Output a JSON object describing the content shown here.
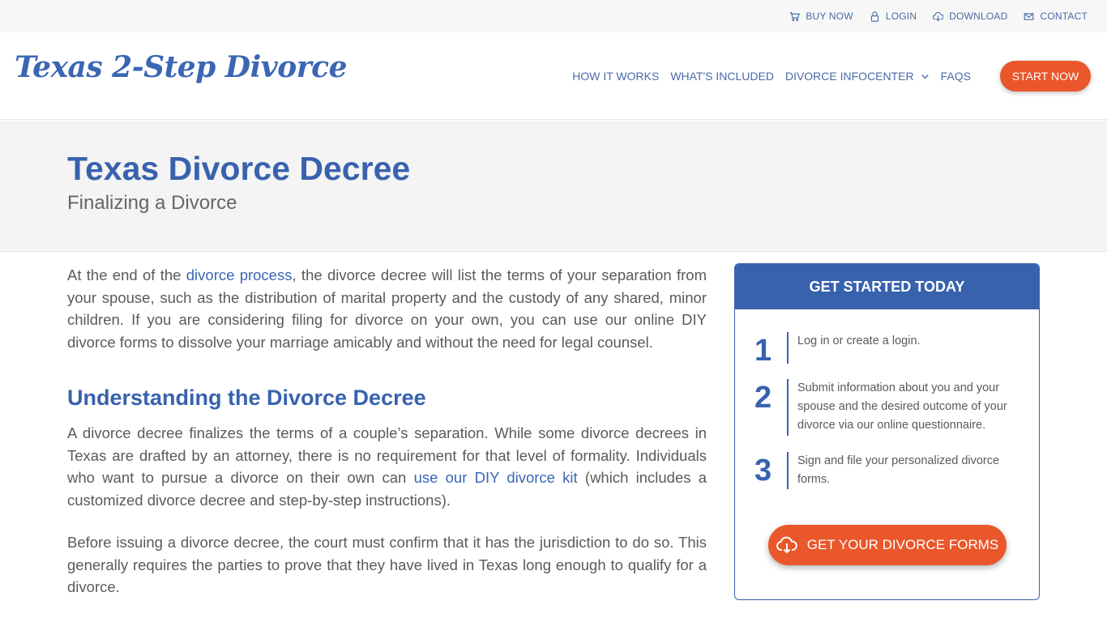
{
  "topbar": {
    "links": [
      {
        "label": "BUY NOW",
        "icon": "cart-icon"
      },
      {
        "label": "LOGIN",
        "icon": "lock-icon"
      },
      {
        "label": "DOWNLOAD",
        "icon": "cloud-download-icon"
      },
      {
        "label": "CONTACT",
        "icon": "envelope-icon"
      }
    ]
  },
  "header": {
    "logo": "Texas 2-Step Divorce",
    "nav": [
      {
        "label": "HOW IT WORKS"
      },
      {
        "label": "WHAT'S INCLUDED"
      },
      {
        "label": "DIVORCE INFOCENTER",
        "icon": "chevron-down-icon"
      },
      {
        "label": "FAQS"
      }
    ],
    "cta": "START NOW"
  },
  "hero": {
    "title": "Texas Divorce Decree",
    "subtitle": "Finalizing a Divorce"
  },
  "article": {
    "p1_before": "At the end of the ",
    "p1_link": "divorce process",
    "p1_after": ", the divorce decree will list the terms of your separation from your spouse, such as the distribution of marital property and the custody of any shared, minor children. If you are considering filing for divorce on your own, you can use our online DIY divorce forms to dissolve your marriage amicably and without the need for legal counsel.",
    "heading": "Understanding the Divorce Decree",
    "p2_before": "A divorce decree finalizes the terms of a couple’s separation. While some divorce decrees in Texas are drafted by an attorney, there is no requirement for that level of formality. Individuals who want to pursue a divorce on their own can ",
    "p2_link": "use our DIY divorce kit",
    "p2_after": " (which includes a customized divorce decree and step-by-step instructions).",
    "p3": "Before issuing a divorce decree, the court must confirm that it has the jurisdiction to do so. This generally requires the parties to prove that they have lived in Texas long enough to qualify for a divorce."
  },
  "sidebar": {
    "title": "GET STARTED TODAY",
    "steps": [
      {
        "num": "1",
        "text": "Log in or create a login."
      },
      {
        "num": "2",
        "text": "Submit information about you and your spouse and the desired outcome of your divorce via our online questionnaire."
      },
      {
        "num": "3",
        "text": "Sign and file your personalized divorce forms."
      }
    ],
    "button": "GET YOUR DIVORCE FORMS"
  },
  "colors": {
    "brand_blue": "#3862ae",
    "accent_orange": "#e9572b"
  }
}
